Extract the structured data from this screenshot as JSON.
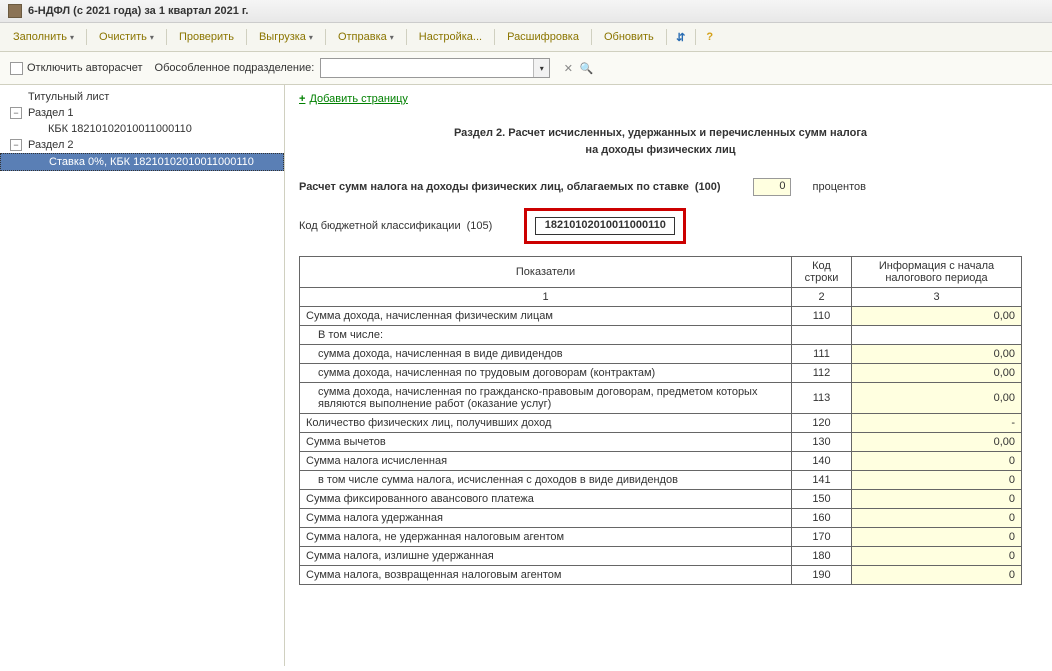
{
  "titlebar": {
    "text": "6-НДФЛ (с 2021 года) за 1 квартал 2021 г."
  },
  "toolbar": {
    "fill": "Заполнить",
    "clear": "Очистить",
    "check": "Проверить",
    "export": "Выгрузка",
    "send": "Отправка",
    "settings": "Настройка...",
    "decode": "Расшифровка",
    "refresh": "Обновить"
  },
  "subtoolbar": {
    "disable_autocalc": "Отключить авторасчет",
    "subdivision_label": "Обособленное подразделение:",
    "subdivision_value": ""
  },
  "sidebar": {
    "title_page": "Титульный лист",
    "section1": "Раздел 1",
    "kbk": "КБК 18210102010011000110",
    "section2": "Раздел 2",
    "rate_kbk": "Ставка 0%, КБК 18210102010011000110"
  },
  "main": {
    "add_page": "Добавить страницу",
    "section_title_1": "Раздел 2. Расчет исчисленных, удержанных и перечисленных сумм налога",
    "section_title_2": "на доходы физических лиц",
    "calc_label": "Расчет сумм налога на доходы физических лиц, облагаемых по ставке",
    "calc_code": "(100)",
    "rate_value": "0",
    "percent_label": "процентов",
    "kbk_label": "Код бюджетной классификации",
    "kbk_code": "(105)",
    "kbk_value": "18210102010011000110"
  },
  "table": {
    "header_indicators": "Показатели",
    "header_line_code": "Код строки",
    "header_period_info": "Информация с начала налогового периода",
    "col1": "1",
    "col2": "2",
    "col3": "3",
    "rows": [
      {
        "label": "Сумма дохода, начисленная физическим лицам",
        "code": "110",
        "value": "0,00",
        "indent": false
      },
      {
        "label": "В том числе:",
        "code": "",
        "value": "",
        "indent": true,
        "noval": true
      },
      {
        "label": "сумма дохода, начисленная в виде дивидендов",
        "code": "111",
        "value": "0,00",
        "indent": true
      },
      {
        "label": "сумма дохода, начисленная по трудовым договорам (контрактам)",
        "code": "112",
        "value": "0,00",
        "indent": true
      },
      {
        "label": "сумма дохода, начисленная по гражданско-правовым договорам, предметом которых являются выполнение работ (оказание услуг)",
        "code": "113",
        "value": "0,00",
        "indent": true
      },
      {
        "label": "Количество физических лиц, получивших доход",
        "code": "120",
        "value": "-",
        "indent": false
      },
      {
        "label": "Сумма вычетов",
        "code": "130",
        "value": "0,00",
        "indent": false
      },
      {
        "label": "Сумма налога исчисленная",
        "code": "140",
        "value": "0",
        "indent": false
      },
      {
        "label": "в том числе сумма налога, исчисленная с доходов в виде дивидендов",
        "code": "141",
        "value": "0",
        "indent": true
      },
      {
        "label": "Сумма фиксированного авансового платежа",
        "code": "150",
        "value": "0",
        "indent": false
      },
      {
        "label": "Сумма налога удержанная",
        "code": "160",
        "value": "0",
        "indent": false
      },
      {
        "label": "Сумма налога, не удержанная налоговым агентом",
        "code": "170",
        "value": "0",
        "indent": false
      },
      {
        "label": "Сумма налога, излишне удержанная",
        "code": "180",
        "value": "0",
        "indent": false
      },
      {
        "label": "Сумма налога, возвращенная налоговым агентом",
        "code": "190",
        "value": "0",
        "indent": false
      }
    ]
  }
}
